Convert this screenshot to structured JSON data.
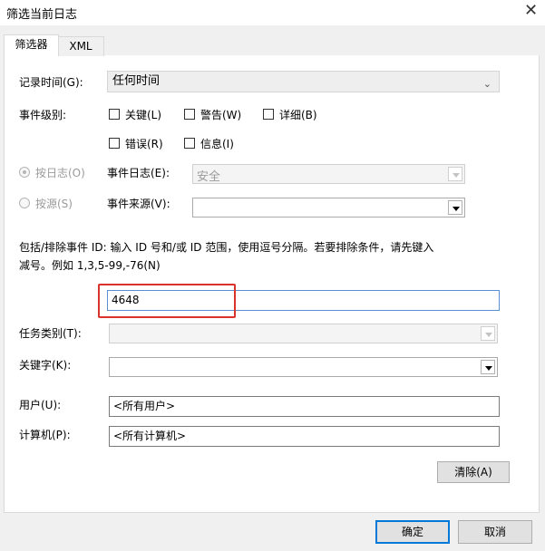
{
  "window": {
    "title": "筛选当前日志",
    "close_glyph": "✕"
  },
  "tabs": [
    {
      "label": "筛选器"
    },
    {
      "label": "XML"
    }
  ],
  "logged": {
    "label": "记录时间(G):",
    "value": "任何时间"
  },
  "event_level": {
    "label": "事件级别:",
    "options": [
      {
        "label": "关键(L)"
      },
      {
        "label": "警告(W)"
      },
      {
        "label": "详细(B)"
      },
      {
        "label": "错误(R)"
      },
      {
        "label": "信息(I)"
      }
    ]
  },
  "by_log": {
    "radio_label": "按日志(O)",
    "field_label": "事件日志(E):",
    "value": "安全"
  },
  "by_source": {
    "radio_label": "按源(S)",
    "field_label": "事件来源(V):",
    "value": ""
  },
  "event_ids": {
    "description_line1": "包括/排除事件 ID: 输入 ID 号和/或 ID 范围，使用逗号分隔。若要排除条件，请先键入",
    "description_line2": "减号。例如 1,3,5-99,-76(N)",
    "value": "4648"
  },
  "task_category": {
    "label": "任务类别(T):",
    "value": ""
  },
  "keywords": {
    "label": "关键字(K):",
    "value": ""
  },
  "user": {
    "label": "用户(U):",
    "value": "<所有用户>"
  },
  "computer": {
    "label": "计算机(P):",
    "value": "<所有计算机>"
  },
  "buttons": {
    "clear": "清除(A)",
    "ok": "确定",
    "cancel": "取消"
  }
}
